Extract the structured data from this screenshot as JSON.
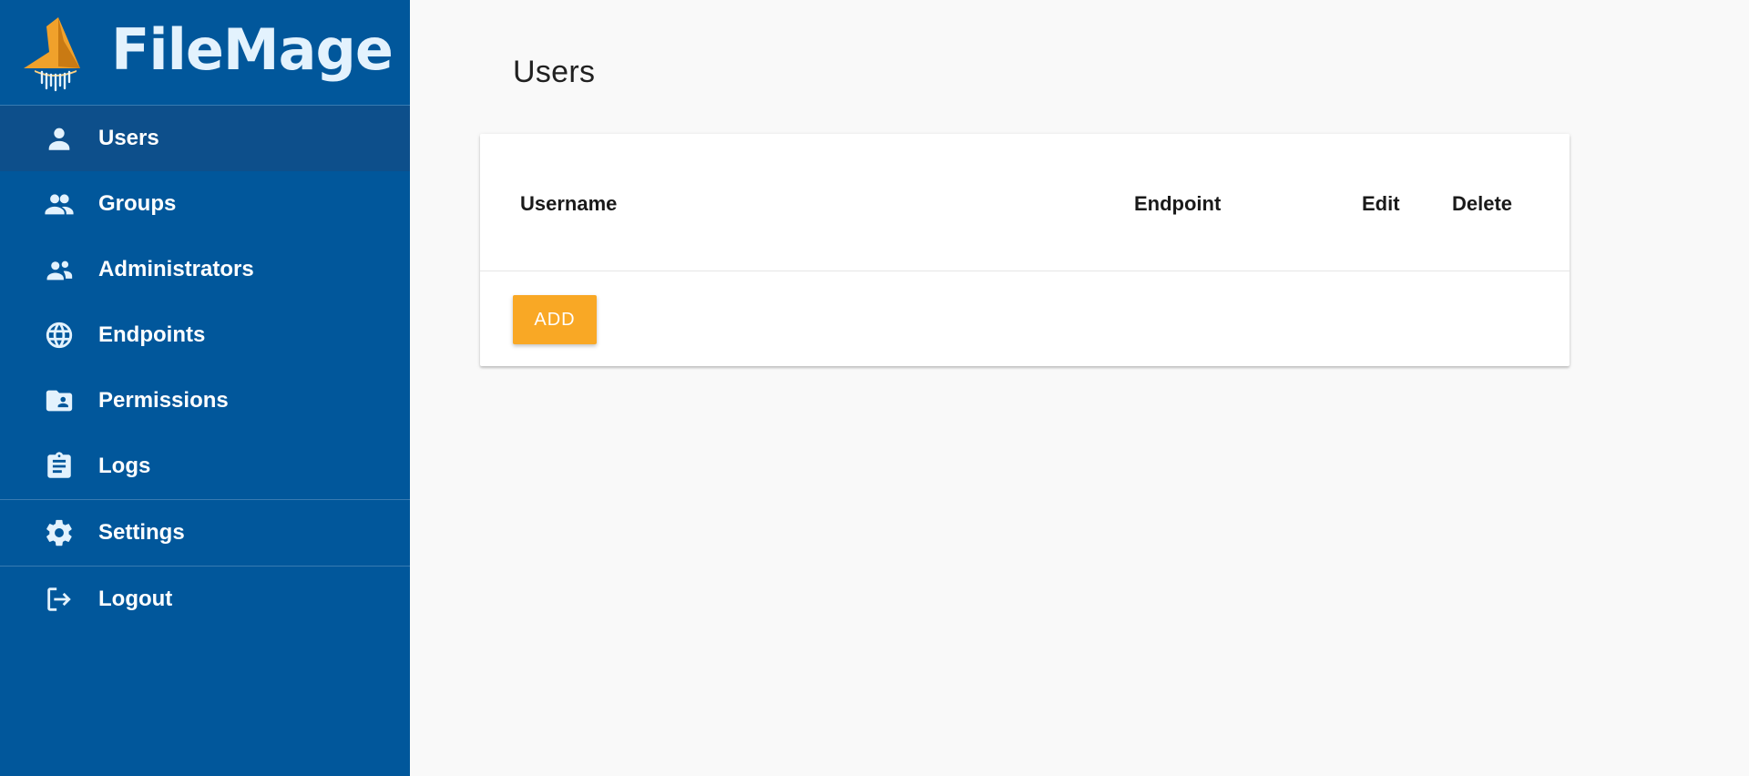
{
  "brand": {
    "name": "FileMage",
    "logo_icon": "wizard-hat-logo-icon"
  },
  "sidebar": {
    "items": [
      {
        "label": "Users",
        "icon": "person-icon",
        "active": true
      },
      {
        "label": "Groups",
        "icon": "people-icon",
        "active": false
      },
      {
        "label": "Administrators",
        "icon": "supervisor-icon",
        "active": false
      },
      {
        "label": "Endpoints",
        "icon": "globe-icon",
        "active": false
      },
      {
        "label": "Permissions",
        "icon": "folder-shared-icon",
        "active": false
      },
      {
        "label": "Logs",
        "icon": "clipboard-icon",
        "active": false
      },
      {
        "label": "Settings",
        "icon": "gear-icon",
        "active": false
      },
      {
        "label": "Logout",
        "icon": "logout-icon",
        "active": false
      }
    ]
  },
  "main": {
    "title": "Users",
    "table": {
      "columns": [
        "Username",
        "Endpoint",
        "Edit",
        "Delete"
      ],
      "rows": []
    },
    "add_label": "ADD"
  },
  "colors": {
    "sidebar_bg": "#01579b",
    "sidebar_active": "#0d4f8b",
    "accent": "#f9a825",
    "page_bg": "#f9f9f9"
  }
}
